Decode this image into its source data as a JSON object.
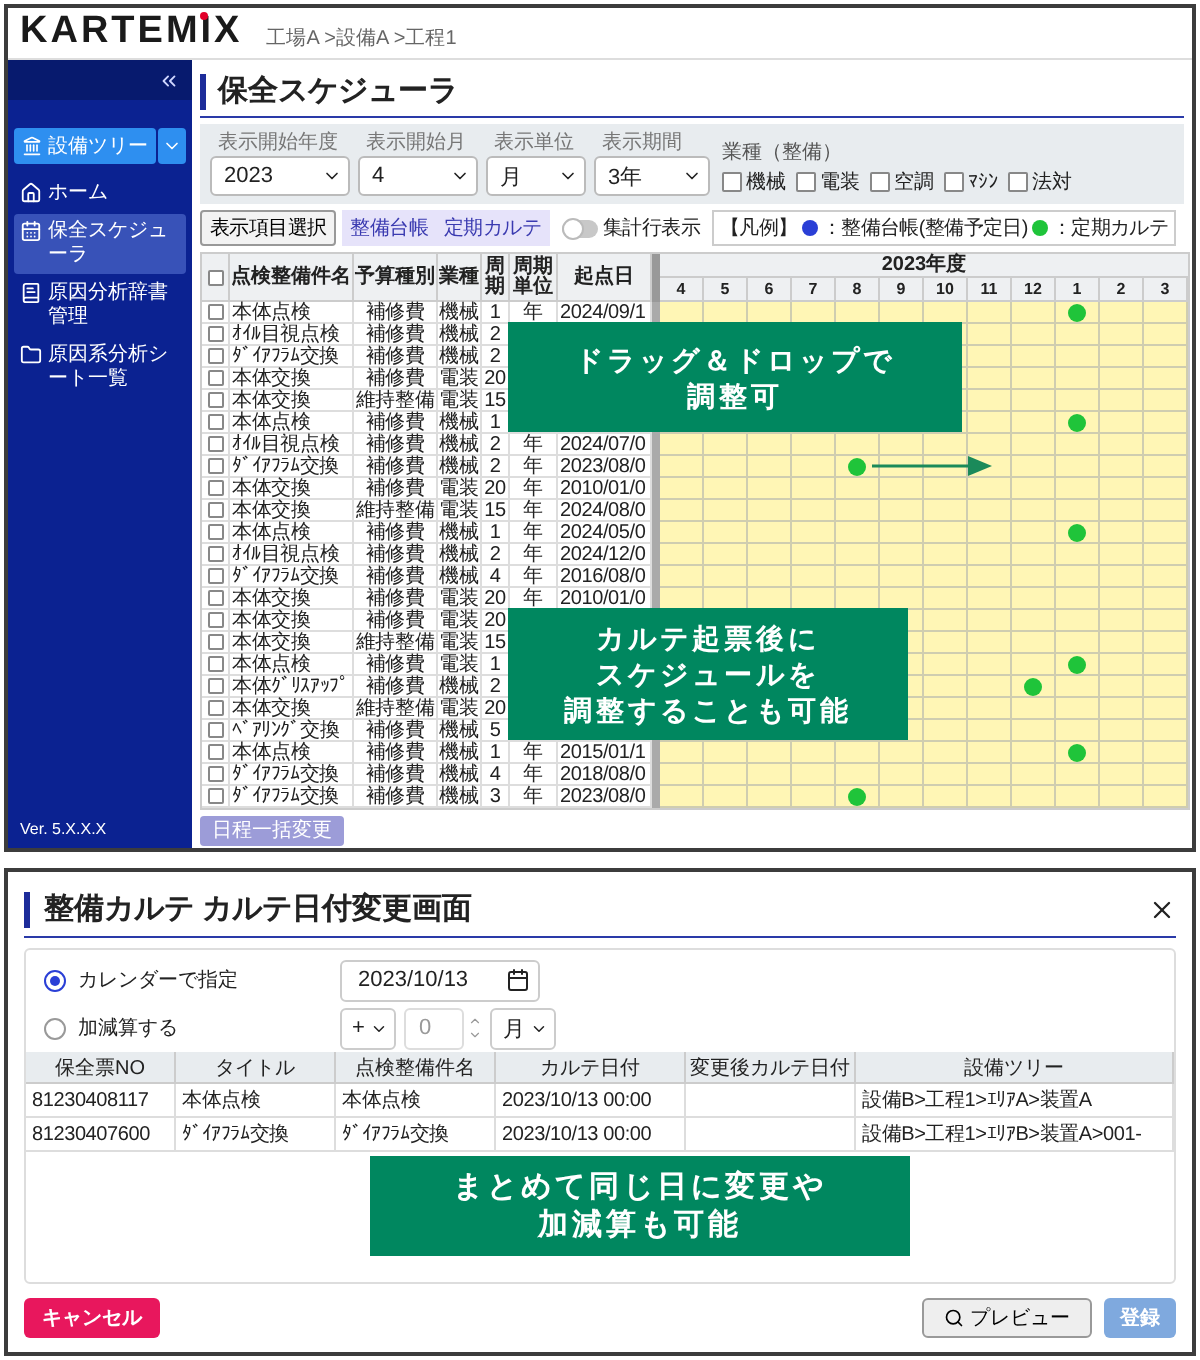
{
  "header": {
    "logo": "KARTEMIX",
    "breadcrumb": "工場A >設備A >工程1"
  },
  "sidebar": {
    "tree_button": "設備ツリー",
    "items": [
      {
        "kind": "home",
        "label": "ホーム",
        "selected": false
      },
      {
        "kind": "schedule",
        "label": "保全スケジューラ",
        "selected": true
      },
      {
        "kind": "dictionary",
        "label": "原因分析辞書管理",
        "selected": false
      },
      {
        "kind": "folder",
        "label": "原因系分析シート一覧",
        "selected": false
      }
    ],
    "version": "Ver. 5.X.X.X"
  },
  "main": {
    "title": "保全スケジューラ",
    "filters": [
      {
        "label": "表示開始年度",
        "value": "2023"
      },
      {
        "label": "表示開始月",
        "value": "4"
      },
      {
        "label": "表示単位",
        "value": "月"
      },
      {
        "label": "表示期間",
        "value": "3年"
      }
    ],
    "category": {
      "label": "業種（整備）",
      "options": [
        {
          "label": "機械",
          "checked": false
        },
        {
          "label": "電装",
          "checked": false
        },
        {
          "label": "空調",
          "checked": false
        },
        {
          "label": "ﾏｼﾝ",
          "checked": false
        },
        {
          "label": "法対",
          "checked": false
        }
      ]
    },
    "display_button": "表示項目選択",
    "views": [
      "整備台帳",
      "定期カルテ"
    ],
    "toggle": {
      "label": "集計行表示",
      "on": false
    },
    "legend": {
      "title": "【凡例】",
      "items": [
        {
          "label": "：整備台帳(整備予定日)",
          "color": "#2a3fd6"
        },
        {
          "label": "：定期カルテ",
          "color": "#1fc43a"
        }
      ]
    },
    "table": {
      "all_checked": false,
      "columns": [
        "点検整備件名",
        "予算種別",
        "業種",
        "周期",
        "周期単位",
        "起点日"
      ],
      "fiscal_year": "2023年度",
      "months": [
        "4",
        "5",
        "6",
        "7",
        "8",
        "9",
        "10",
        "11",
        "12",
        "1",
        "2",
        "3"
      ],
      "rows": [
        {
          "checked": false,
          "name": "本体点検",
          "budget": "補修費",
          "industry": "機械",
          "cycle": "1",
          "unit": "年",
          "start": "2024/09/1",
          "karte": [
            false,
            false,
            false,
            false,
            false,
            false,
            false,
            false,
            false,
            true,
            false,
            false
          ]
        },
        {
          "checked": false,
          "name": "ｵｲﾙ目視点検",
          "budget": "補修費",
          "industry": "機械",
          "cycle": "2"
        },
        {
          "checked": false,
          "name": "ﾀﾞｲｱﾌﾗﾑ交換",
          "budget": "補修費",
          "industry": "機械",
          "cycle": "2"
        },
        {
          "checked": false,
          "name": "本体交換",
          "budget": "補修費",
          "industry": "電装",
          "cycle": "20"
        },
        {
          "checked": false,
          "name": "本体交換",
          "budget": "維持整備",
          "industry": "電装",
          "cycle": "15"
        },
        {
          "checked": false,
          "name": "本体点検",
          "budget": "補修費",
          "industry": "機械",
          "cycle": "1",
          "karte": [
            false,
            false,
            false,
            false,
            false,
            false,
            false,
            false,
            false,
            true,
            false,
            false
          ]
        },
        {
          "checked": false,
          "name": "ｵｲﾙ目視点検",
          "budget": "補修費",
          "industry": "機械",
          "cycle": "2",
          "unit": "年",
          "start": "2024/07/0"
        },
        {
          "checked": false,
          "name": "ﾀﾞｲｱﾌﾗﾑ交換",
          "budget": "補修費",
          "industry": "機械",
          "cycle": "2",
          "unit": "年",
          "start": "2023/08/0",
          "karte": [
            false,
            false,
            false,
            false,
            true,
            false,
            false,
            false,
            false,
            false,
            false,
            false
          ]
        },
        {
          "checked": false,
          "name": "本体交換",
          "budget": "補修費",
          "industry": "電装",
          "cycle": "20",
          "unit": "年",
          "start": "2010/01/0"
        },
        {
          "checked": false,
          "name": "本体交換",
          "budget": "維持整備",
          "industry": "電装",
          "cycle": "15",
          "unit": "年",
          "start": "2024/08/0"
        },
        {
          "checked": false,
          "name": "本体点検",
          "budget": "補修費",
          "industry": "機械",
          "cycle": "1",
          "unit": "年",
          "start": "2024/05/0",
          "karte": [
            false,
            false,
            false,
            false,
            false,
            false,
            false,
            false,
            false,
            true,
            false,
            false
          ]
        },
        {
          "checked": false,
          "name": "ｵｲﾙ目視点検",
          "budget": "補修費",
          "industry": "機械",
          "cycle": "2",
          "unit": "年",
          "start": "2024/12/0"
        },
        {
          "checked": false,
          "name": "ﾀﾞｲｱﾌﾗﾑ交換",
          "budget": "補修費",
          "industry": "機械",
          "cycle": "4",
          "unit": "年",
          "start": "2016/08/0"
        },
        {
          "checked": false,
          "name": "本体交換",
          "budget": "補修費",
          "industry": "電装",
          "cycle": "20",
          "unit": "年",
          "start": "2010/01/0"
        },
        {
          "checked": false,
          "name": "本体交換",
          "budget": "補修費",
          "industry": "電装",
          "cycle": "20"
        },
        {
          "checked": false,
          "name": "本体交換",
          "budget": "維持整備",
          "industry": "電装",
          "cycle": "15"
        },
        {
          "checked": false,
          "name": "本体点検",
          "budget": "補修費",
          "industry": "電装",
          "cycle": "1",
          "karte": [
            false,
            false,
            false,
            false,
            false,
            false,
            false,
            false,
            false,
            true,
            false,
            false
          ]
        },
        {
          "checked": false,
          "name": "本体ｸﾞﾘｽｱｯﾌﾟ",
          "budget": "補修費",
          "industry": "機械",
          "cycle": "2",
          "karte": [
            false,
            false,
            false,
            false,
            false,
            false,
            false,
            false,
            true,
            false,
            false,
            false
          ]
        },
        {
          "checked": false,
          "name": "本体交換",
          "budget": "維持整備",
          "industry": "電装",
          "cycle": "20"
        },
        {
          "checked": false,
          "name": "ﾍﾞｱﾘﾝｸﾞ交換",
          "budget": "補修費",
          "industry": "機械",
          "cycle": "5"
        },
        {
          "checked": false,
          "name": "本体点検",
          "budget": "補修費",
          "industry": "機械",
          "cycle": "1",
          "unit": "年",
          "start": "2015/01/1",
          "karte": [
            false,
            false,
            false,
            false,
            false,
            false,
            false,
            false,
            false,
            true,
            false,
            false
          ]
        },
        {
          "checked": false,
          "name": "ﾀﾞｲｱﾌﾗﾑ交換",
          "budget": "補修費",
          "industry": "機械",
          "cycle": "4",
          "unit": "年",
          "start": "2018/08/0"
        },
        {
          "checked": false,
          "name": "ﾀﾞｲｱﾌﾗﾑ交換",
          "budget": "補修費",
          "industry": "機械",
          "cycle": "3",
          "unit": "年",
          "start": "2023/08/0",
          "karte": [
            false,
            false,
            false,
            false,
            true,
            false,
            false,
            false,
            false,
            false,
            false,
            false
          ]
        }
      ]
    },
    "callouts": [
      {
        "lines": [
          "ドラッグ＆ドロップで",
          "調整可"
        ]
      },
      {
        "lines": [
          "カルテ起票後に",
          "スケジュールを",
          "調整することも可能"
        ]
      }
    ],
    "bulk_button": {
      "label": "日程一括変更",
      "disabled": true
    }
  },
  "dialog": {
    "title": "整備カルテ カルテ日付変更画面",
    "options": [
      {
        "label": "カレンダーで指定",
        "selected": true
      },
      {
        "label": "加減算する",
        "selected": false
      }
    ],
    "date": "2023/10/13",
    "sign": "+",
    "amount_placeholder": "0",
    "unit": "月",
    "table": {
      "columns": [
        "保全票NO",
        "タイトル",
        "点検整備件名",
        "カルテ日付",
        "変更後カルテ日付",
        "設備ツリー"
      ],
      "rows": [
        {
          "no": "81230408117",
          "title": "本体点検",
          "name": "本体点検",
          "date": "2023/10/13 00:00",
          "tree": "設備B>工程1>ｴﾘｱA>装置A"
        },
        {
          "no": "81230407600",
          "title": "ﾀﾞｲｱﾌﾗﾑ交換",
          "name": "ﾀﾞｲｱﾌﾗﾑ交換",
          "date": "2023/10/13 00:00",
          "tree": "設備B>工程1>ｴﾘｱB>装置A>001-"
        }
      ]
    },
    "callout": {
      "lines": [
        "まとめて同じ日に変更や",
        "加減算も可能"
      ]
    },
    "cancel": "キャンセル",
    "preview": "プレビュー",
    "register": {
      "label": "登録",
      "disabled": true
    }
  }
}
